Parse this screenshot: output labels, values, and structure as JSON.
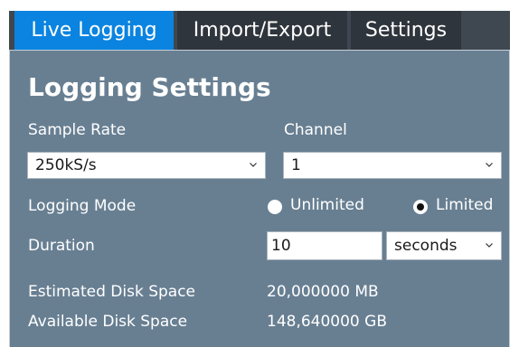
{
  "tabs": {
    "live_logging": "Live Logging",
    "import_export": "Import/Export",
    "settings": "Settings"
  },
  "panel": {
    "heading": "Logging Settings",
    "sample_rate": {
      "label": "Sample Rate",
      "value": "250kS/s"
    },
    "channel": {
      "label": "Channel",
      "value": "1"
    },
    "logging_mode": {
      "label": "Logging Mode",
      "options": [
        "Unlimited",
        "Limited"
      ],
      "selected": "Limited"
    },
    "duration": {
      "label": "Duration",
      "value": "10",
      "unit": "seconds"
    },
    "estimated_disk_space": {
      "label": "Estimated Disk Space",
      "value": "20,000000 MB"
    },
    "available_disk_space": {
      "label": "Available Disk Space",
      "value": "148,640000 GB"
    }
  },
  "colors": {
    "active_tab": "#0a84e0",
    "tab_bar": "#3f4750",
    "panel_bg": "#687f92"
  },
  "icons": {
    "dropdown": "chevron-down-icon"
  }
}
